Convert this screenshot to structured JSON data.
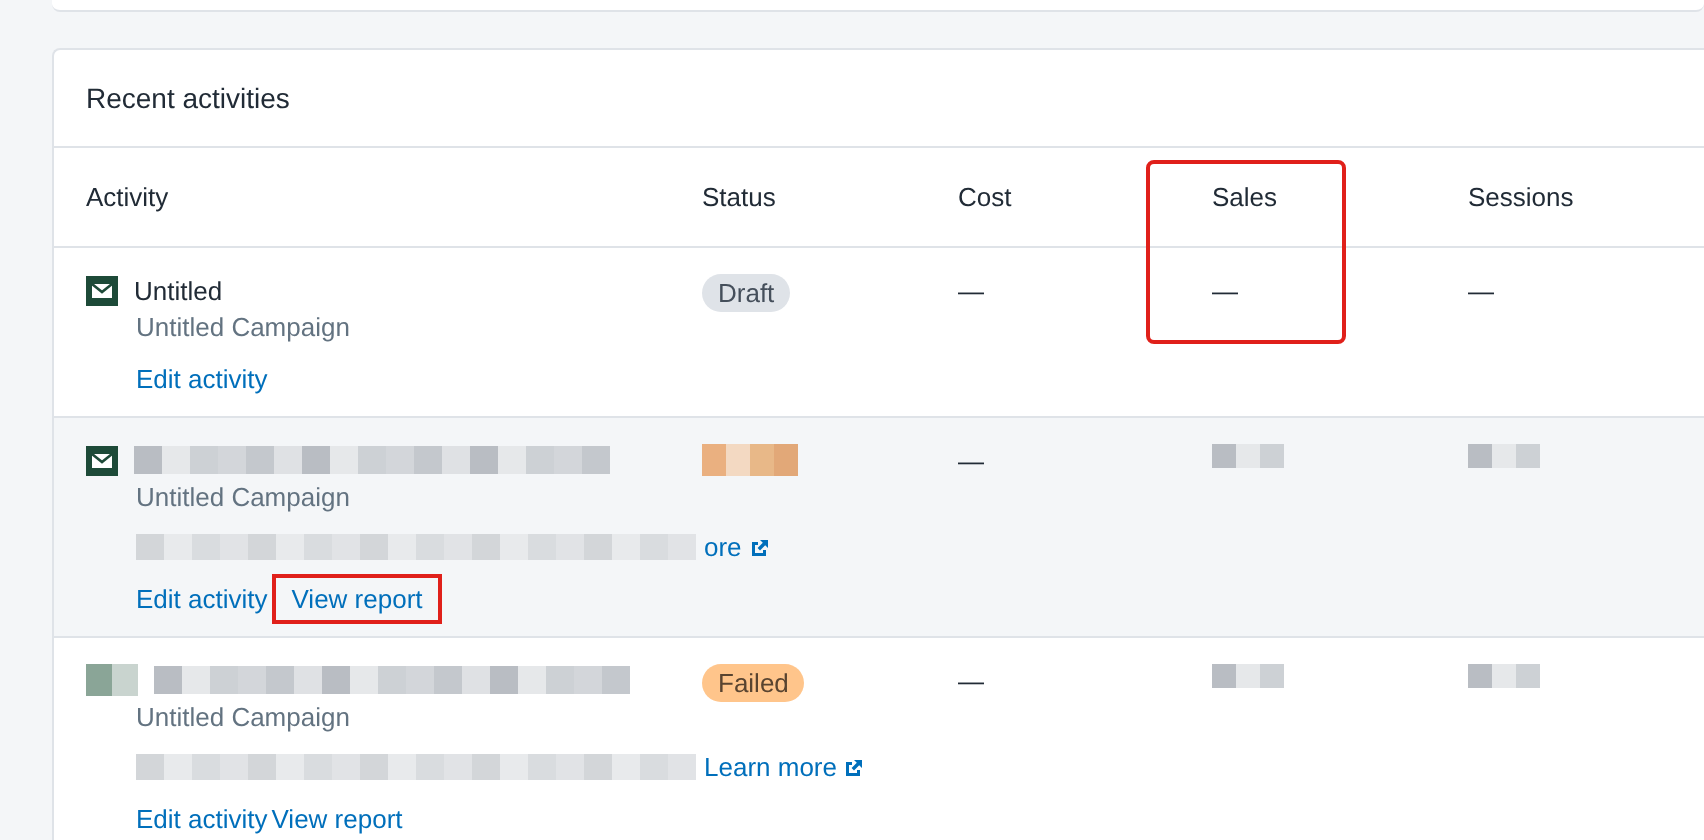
{
  "section": {
    "title": "Recent activities"
  },
  "columns": [
    {
      "label": "Activity",
      "highlighted": false
    },
    {
      "label": "Status",
      "highlighted": false
    },
    {
      "label": "Cost",
      "highlighted": false
    },
    {
      "label": "Sales",
      "highlighted": true
    },
    {
      "label": "Sessions",
      "highlighted": false
    }
  ],
  "rows": [
    {
      "hovered": false,
      "icon_blurred": false,
      "name": "Untitled",
      "campaign": "Untitled Campaign",
      "status": {
        "kind": "draft",
        "label": "Draft"
      },
      "cost": "—",
      "sales": "—",
      "sessions": "—",
      "links": [
        {
          "label": "Edit activity",
          "highlighted": false
        }
      ]
    },
    {
      "hovered": true,
      "icon_blurred": false,
      "name": {
        "kind": "blurred"
      },
      "campaign": "Untitled Campaign",
      "status": {
        "kind": "blurred"
      },
      "note": {
        "link": "ore"
      },
      "cost": "—",
      "sales": {
        "kind": "blurred"
      },
      "sessions": {
        "kind": "blurred"
      },
      "links": [
        {
          "label": "Edit activity",
          "highlighted": false
        },
        {
          "label": "View report",
          "highlighted": true
        }
      ]
    },
    {
      "hovered": false,
      "icon_blurred": true,
      "name": {
        "kind": "blurred"
      },
      "campaign": "Untitled Campaign",
      "status": {
        "kind": "failed",
        "label": "Failed"
      },
      "note": {
        "link": "Learn more"
      },
      "cost": "—",
      "sales": {
        "kind": "blurred"
      },
      "sessions": {
        "kind": "blurred"
      },
      "links": [
        {
          "label": "Edit activity",
          "highlighted": false
        },
        {
          "label": "View report",
          "highlighted": false
        }
      ]
    }
  ]
}
